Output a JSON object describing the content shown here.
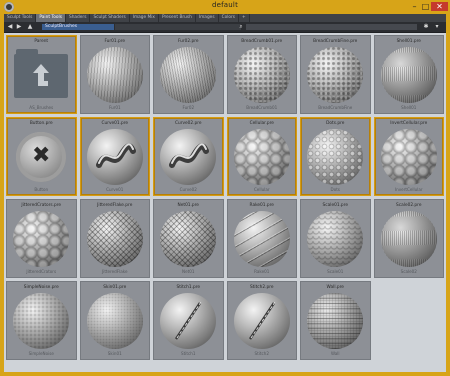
{
  "window": {
    "title": "default"
  },
  "tabs": [
    {
      "label": "Sculpt Tools",
      "active": false
    },
    {
      "label": "Paint Tools",
      "active": true
    },
    {
      "label": "Shaders",
      "active": false
    },
    {
      "label": "Sculpt Shaders",
      "active": false
    },
    {
      "label": "Image Mix",
      "active": false
    },
    {
      "label": "Present Brush",
      "active": false
    },
    {
      "label": "Images",
      "active": false
    },
    {
      "label": "Colors",
      "active": false
    }
  ],
  "pathbar": {
    "path": "SculptBrushes"
  },
  "tiles": [
    {
      "top": "Parent",
      "bottom": "AS_Brushes",
      "kind": "folder",
      "selected": true
    },
    {
      "top": "Fur01.pre",
      "bottom": "Fur01",
      "kind": "t-fur",
      "selected": false
    },
    {
      "top": "Fur02.pre",
      "bottom": "Fur02",
      "kind": "t-fur2",
      "selected": false
    },
    {
      "top": "BreadCrumb01.pre",
      "bottom": "BreadCrumb01",
      "kind": "t-crumb",
      "selected": false
    },
    {
      "top": "BreadCrumbFine.pre",
      "bottom": "BreadCrumbFine",
      "kind": "t-crumb",
      "selected": false
    },
    {
      "top": "Shell01.pre",
      "bottom": "Shell01",
      "kind": "t-bark",
      "selected": false
    },
    {
      "top": "Button.pre",
      "bottom": "Button",
      "kind": "button",
      "selected": true
    },
    {
      "top": "Curve01.pre",
      "bottom": "Curve01",
      "kind": "curve",
      "selected": true
    },
    {
      "top": "Curve02.pre",
      "bottom": "Curve02",
      "kind": "curve",
      "selected": true
    },
    {
      "top": "Cellular.pre",
      "bottom": "Cellular",
      "kind": "t-cell",
      "selected": true
    },
    {
      "top": "Dots.pre",
      "bottom": "Dots",
      "kind": "t-dots",
      "selected": true
    },
    {
      "top": "InvertCellular.pre",
      "bottom": "InvertCellular",
      "kind": "t-cell",
      "selected": true
    },
    {
      "top": "JitteredCrators.pre",
      "bottom": "JitteredCrators",
      "kind": "t-cell",
      "selected": false
    },
    {
      "top": "JitteredFlake.pre",
      "bottom": "JitteredFlake",
      "kind": "t-cross",
      "selected": false
    },
    {
      "top": "Net01.pre",
      "bottom": "Net01",
      "kind": "t-cross",
      "selected": false
    },
    {
      "top": "Rake01.pre",
      "bottom": "Rake01",
      "kind": "t-lines",
      "selected": false
    },
    {
      "top": "Scale01.pre",
      "bottom": "Scale01",
      "kind": "t-scale",
      "selected": false
    },
    {
      "top": "Scale02.pre",
      "bottom": "Scale02",
      "kind": "t-bark",
      "selected": false
    },
    {
      "top": "SimpleNoise.pre",
      "bottom": "SimpleNoise",
      "kind": "t-noise",
      "selected": false
    },
    {
      "top": "Skin01.pre",
      "bottom": "Skin01",
      "kind": "t-skin",
      "selected": false
    },
    {
      "top": "Stitch1.pre",
      "bottom": "Stitch1",
      "kind": "stitch",
      "selected": false
    },
    {
      "top": "Stitch2.pre",
      "bottom": "Stitch2",
      "kind": "stitch",
      "selected": false
    },
    {
      "top": "Wall.pre",
      "bottom": "Wall",
      "kind": "t-wall",
      "selected": false
    }
  ],
  "colors": {
    "frame": "#d7a418",
    "selection": "#d59c12",
    "tile": "#8d9096",
    "panel": "#cfd3d8"
  },
  "icons": [
    "app-icon",
    "back-icon",
    "forward-icon",
    "up-icon",
    "search-icon",
    "settings-icon",
    "view-icon"
  ]
}
